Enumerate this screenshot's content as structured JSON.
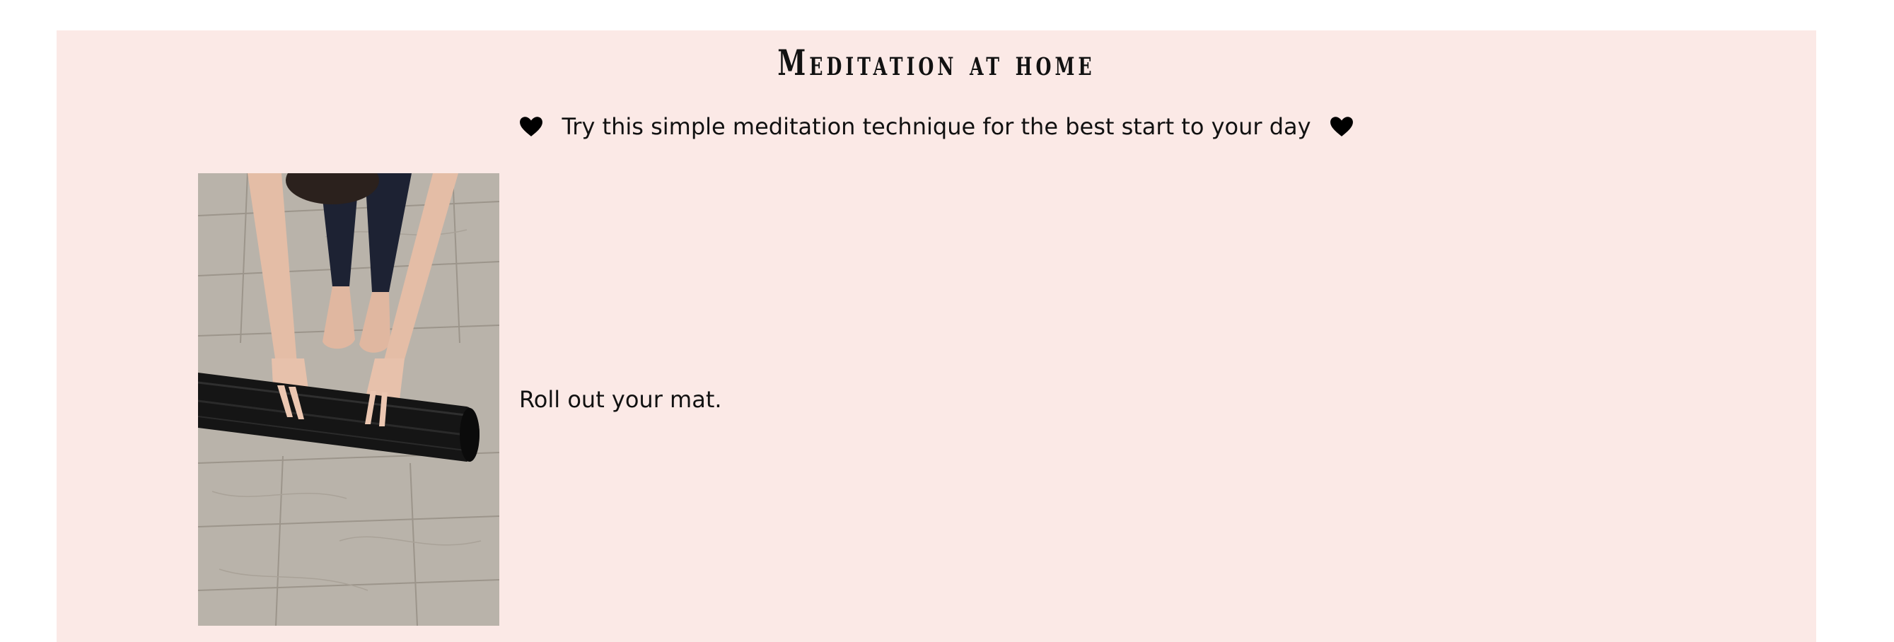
{
  "header": {
    "title": "Meditation at home",
    "subtitle": "Try this simple meditation technique for the best start to your day",
    "subtitle_icon": "heart-icon"
  },
  "steps": [
    {
      "image": "yoga-mat-rolling-photo",
      "text": "Roll out your mat."
    }
  ],
  "colors": {
    "page_background": "#ffffff",
    "card_background": "#fbe9e6",
    "text": "#111111"
  }
}
